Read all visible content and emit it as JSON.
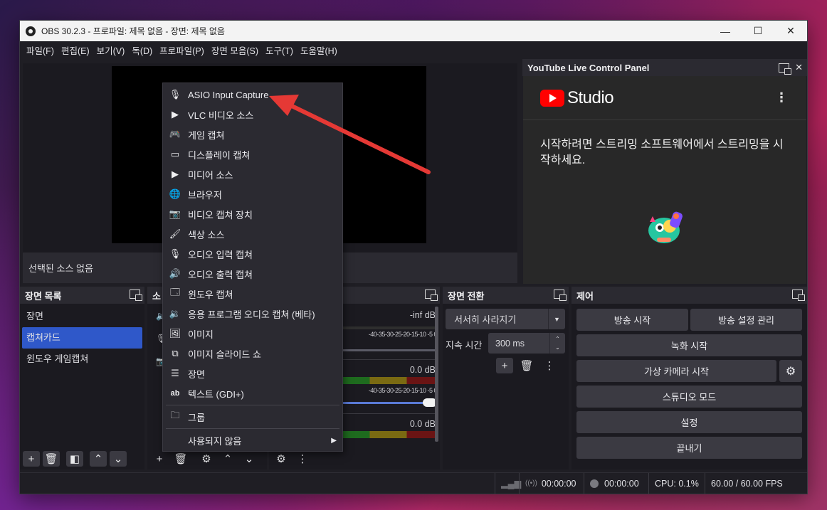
{
  "window": {
    "title": "OBS 30.2.3 - 프로파일: 제목 없음 - 장면: 제목 없음",
    "minimize": "—",
    "maximize": "☐",
    "close": "✕"
  },
  "menu": [
    "파일(F)",
    "편집(E)",
    "보기(V)",
    "독(D)",
    "프로파일(P)",
    "장면 모음(S)",
    "도구(T)",
    "도움말(H)"
  ],
  "preview": {
    "no_source": "선택된 소스 없음"
  },
  "youtube": {
    "header": "YouTube Live Control Panel",
    "studio": "Studio",
    "message": "시작하려면 스트리밍 소프트웨어에서 스트리밍을 시작하세요."
  },
  "scenes": {
    "header": "장면 목록",
    "items": [
      "장면",
      "캡쳐카드",
      "윈도우 게임캡쳐"
    ],
    "selected_index": 1
  },
  "sources": {
    "header": "소"
  },
  "mixer": {
    "rows": [
      {
        "db": "-inf dB",
        "scale": "-40-35-30-25-20-15-10 -5  0"
      },
      {
        "db": "0.0 dB",
        "scale": "-40-35-30-25-20-15-10 -5  0",
        "volume": 1.0
      },
      {
        "db": "0.0 dB"
      }
    ]
  },
  "transitions": {
    "header": "장면 전환",
    "type": "서서히 사라지기",
    "duration_label": "지속 시간",
    "duration": "300 ms"
  },
  "controls": {
    "header": "제어",
    "start_stream": "방송 시작",
    "stream_settings": "방송 설정 관리",
    "start_record": "녹화 시작",
    "virtual_cam": "가상 카메라 시작",
    "studio_mode": "스튜디오 모드",
    "settings": "설정",
    "exit": "끝내기"
  },
  "status": {
    "stream_time": "00:00:00",
    "record_time": "00:00:00",
    "cpu": "CPU: 0.1%",
    "fps": "60.00 / 60.00 FPS"
  },
  "context_menu": {
    "items": [
      {
        "label": "ASIO Input Capture",
        "icon": "microphone-icon"
      },
      {
        "label": "VLC 비디오 소스",
        "icon": "play-icon"
      },
      {
        "label": "게임 캡쳐",
        "icon": "gamepad-icon"
      },
      {
        "label": "디스플레이 캡쳐",
        "icon": "monitor-icon"
      },
      {
        "label": "미디어 소스",
        "icon": "play-icon"
      },
      {
        "label": "브라우저",
        "icon": "globe-icon"
      },
      {
        "label": "비디오 캡쳐 장치",
        "icon": "camera-icon"
      },
      {
        "label": "색상 소스",
        "icon": "brush-icon"
      },
      {
        "label": "오디오 입력 캡쳐",
        "icon": "microphone-icon"
      },
      {
        "label": "오디오 출력 캡쳐",
        "icon": "speaker-icon"
      },
      {
        "label": "윈도우 캡쳐",
        "icon": "window-icon"
      },
      {
        "label": "응용 프로그램 오디오 캡쳐 (베타)",
        "icon": "app-audio-icon"
      },
      {
        "label": "이미지",
        "icon": "image-icon"
      },
      {
        "label": "이미지 슬라이드 쇼",
        "icon": "slideshow-icon"
      },
      {
        "label": "장면",
        "icon": "list-icon"
      },
      {
        "label": "텍스트 (GDI+)",
        "icon": "text-icon"
      },
      {
        "label": "그룹",
        "icon": "folder-icon"
      },
      {
        "label": "사용되지 않음",
        "icon": ""
      }
    ],
    "submenu_arrow": "▶"
  },
  "annotation": {
    "color": "#e53935"
  }
}
